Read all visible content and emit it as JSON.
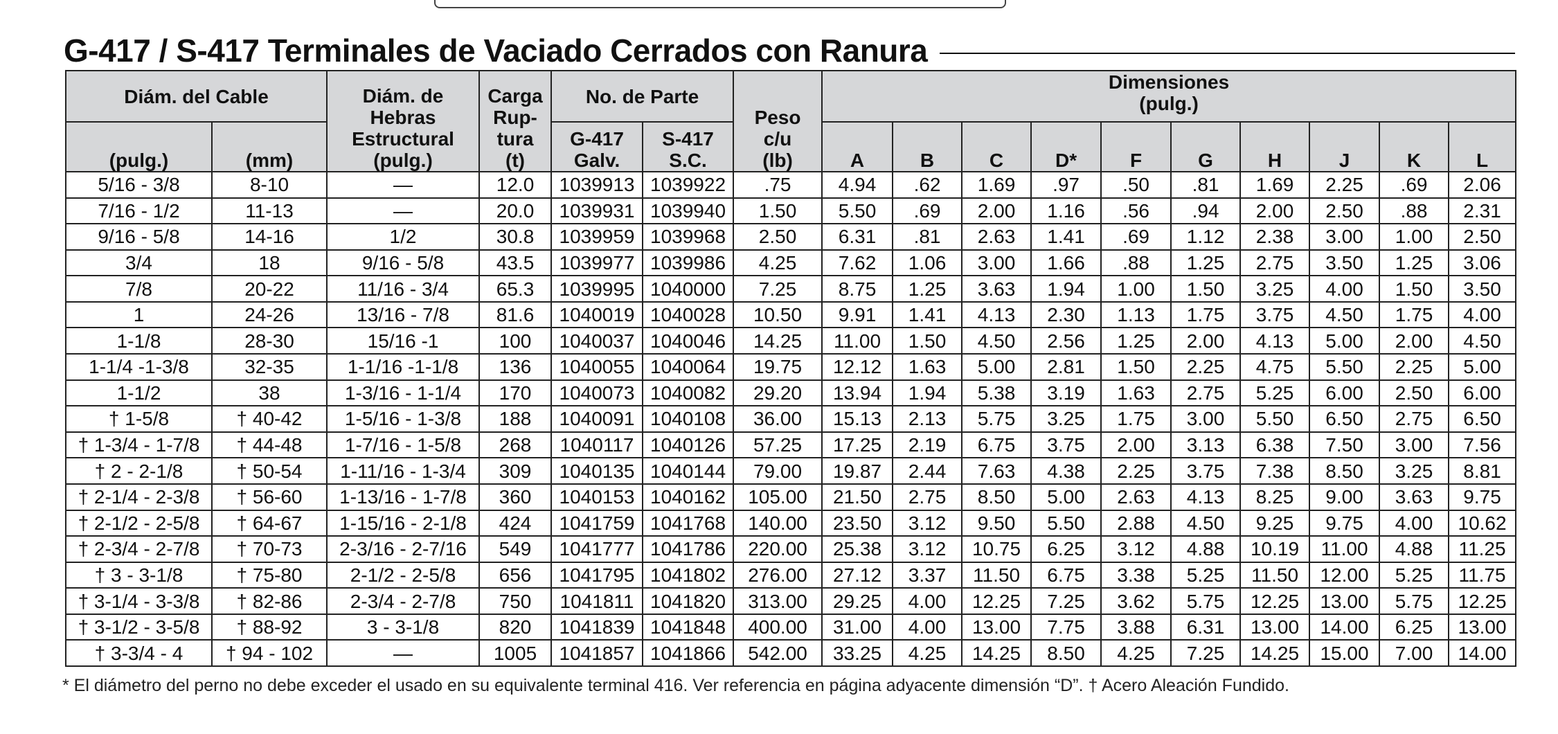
{
  "title": "G-417 / S-417 Terminales de Vaciado Cerrados con Ranura",
  "header": {
    "cable_diam": "Diám. del Cable",
    "pulg": "(pulg.)",
    "mm": "(mm)",
    "strand_l1": "Diám. de",
    "strand_l2": "Hebras",
    "strand_l3": "Estructural",
    "strand_l4": "(pulg.)",
    "load_l1": "Carga",
    "load_l2": "Rup-",
    "load_l3": "tura",
    "load_l4": "(t)",
    "part_no": "No. de Parte",
    "g417_l1": "G-417",
    "g417_l2": "Galv.",
    "s417_l1": "S-417",
    "s417_l2": "S.C.",
    "weight_l1": "Peso",
    "weight_l2": "c/u",
    "weight_l3": "(lb)",
    "dims_l1": "Dimensiones",
    "dims_l2": "(pulg.)",
    "dim_letters": [
      "A",
      "B",
      "C",
      "D*",
      "F",
      "G",
      "H",
      "J",
      "K",
      "L"
    ]
  },
  "rows": [
    [
      "5/16 - 3/8",
      "8-10",
      "—",
      "12.0",
      "1039913",
      "1039922",
      ".75",
      "4.94",
      ".62",
      "1.69",
      ".97",
      ".50",
      ".81",
      "1.69",
      "2.25",
      ".69",
      "2.06"
    ],
    [
      "7/16 - 1/2",
      "11-13",
      "—",
      "20.0",
      "1039931",
      "1039940",
      "1.50",
      "5.50",
      ".69",
      "2.00",
      "1.16",
      ".56",
      ".94",
      "2.00",
      "2.50",
      ".88",
      "2.31"
    ],
    [
      "9/16 - 5/8",
      "14-16",
      "1/2",
      "30.8",
      "1039959",
      "1039968",
      "2.50",
      "6.31",
      ".81",
      "2.63",
      "1.41",
      ".69",
      "1.12",
      "2.38",
      "3.00",
      "1.00",
      "2.50"
    ],
    [
      "3/4",
      "18",
      "9/16 - 5/8",
      "43.5",
      "1039977",
      "1039986",
      "4.25",
      "7.62",
      "1.06",
      "3.00",
      "1.66",
      ".88",
      "1.25",
      "2.75",
      "3.50",
      "1.25",
      "3.06"
    ],
    [
      "7/8",
      "20-22",
      "11/16 - 3/4",
      "65.3",
      "1039995",
      "1040000",
      "7.25",
      "8.75",
      "1.25",
      "3.63",
      "1.94",
      "1.00",
      "1.50",
      "3.25",
      "4.00",
      "1.50",
      "3.50"
    ],
    [
      "1",
      "24-26",
      "13/16 - 7/8",
      "81.6",
      "1040019",
      "1040028",
      "10.50",
      "9.91",
      "1.41",
      "4.13",
      "2.30",
      "1.13",
      "1.75",
      "3.75",
      "4.50",
      "1.75",
      "4.00"
    ],
    [
      "1-1/8",
      "28-30",
      "15/16 -1",
      "100",
      "1040037",
      "1040046",
      "14.25",
      "11.00",
      "1.50",
      "4.50",
      "2.56",
      "1.25",
      "2.00",
      "4.13",
      "5.00",
      "2.00",
      "4.50"
    ],
    [
      "1-1/4 -1-3/8",
      "32-35",
      "1-1/16 -1-1/8",
      "136",
      "1040055",
      "1040064",
      "19.75",
      "12.12",
      "1.63",
      "5.00",
      "2.81",
      "1.50",
      "2.25",
      "4.75",
      "5.50",
      "2.25",
      "5.00"
    ],
    [
      "1-1/2",
      "38",
      "1-3/16 - 1-1/4",
      "170",
      "1040073",
      "1040082",
      "29.20",
      "13.94",
      "1.94",
      "5.38",
      "3.19",
      "1.63",
      "2.75",
      "5.25",
      "6.00",
      "2.50",
      "6.00"
    ],
    [
      "† 1-5/8",
      "† 40-42",
      "1-5/16 - 1-3/8",
      "188",
      "1040091",
      "1040108",
      "36.00",
      "15.13",
      "2.13",
      "5.75",
      "3.25",
      "1.75",
      "3.00",
      "5.50",
      "6.50",
      "2.75",
      "6.50"
    ],
    [
      "† 1-3/4 - 1-7/8",
      "† 44-48",
      "1-7/16 - 1-5/8",
      "268",
      "1040117",
      "1040126",
      "57.25",
      "17.25",
      "2.19",
      "6.75",
      "3.75",
      "2.00",
      "3.13",
      "6.38",
      "7.50",
      "3.00",
      "7.56"
    ],
    [
      "† 2 - 2-1/8",
      "† 50-54",
      "1-11/16 - 1-3/4",
      "309",
      "1040135",
      "1040144",
      "79.00",
      "19.87",
      "2.44",
      "7.63",
      "4.38",
      "2.25",
      "3.75",
      "7.38",
      "8.50",
      "3.25",
      "8.81"
    ],
    [
      "† 2-1/4 - 2-3/8",
      "† 56-60",
      "1-13/16 - 1-7/8",
      "360",
      "1040153",
      "1040162",
      "105.00",
      "21.50",
      "2.75",
      "8.50",
      "5.00",
      "2.63",
      "4.13",
      "8.25",
      "9.00",
      "3.63",
      "9.75"
    ],
    [
      "† 2-1/2 - 2-5/8",
      "† 64-67",
      "1-15/16 - 2-1/8",
      "424",
      "1041759",
      "1041768",
      "140.00",
      "23.50",
      "3.12",
      "9.50",
      "5.50",
      "2.88",
      "4.50",
      "9.25",
      "9.75",
      "4.00",
      "10.62"
    ],
    [
      "† 2-3/4 - 2-7/8",
      "† 70-73",
      "2-3/16 - 2-7/16",
      "549",
      "1041777",
      "1041786",
      "220.00",
      "25.38",
      "3.12",
      "10.75",
      "6.25",
      "3.12",
      "4.88",
      "10.19",
      "11.00",
      "4.88",
      "11.25"
    ],
    [
      "† 3 - 3-1/8",
      "† 75-80",
      "2-1/2 - 2-5/8",
      "656",
      "1041795",
      "1041802",
      "276.00",
      "27.12",
      "3.37",
      "11.50",
      "6.75",
      "3.38",
      "5.25",
      "11.50",
      "12.00",
      "5.25",
      "11.75"
    ],
    [
      "† 3-1/4 - 3-3/8",
      "† 82-86",
      "2-3/4 - 2-7/8",
      "750",
      "1041811",
      "1041820",
      "313.00",
      "29.25",
      "4.00",
      "12.25",
      "7.25",
      "3.62",
      "5.75",
      "12.25",
      "13.00",
      "5.75",
      "12.25"
    ],
    [
      "† 3-1/2 - 3-5/8",
      "† 88-92",
      "3 - 3-1/8",
      "820",
      "1041839",
      "1041848",
      "400.00",
      "31.00",
      "4.00",
      "13.00",
      "7.75",
      "3.88",
      "6.31",
      "13.00",
      "14.00",
      "6.25",
      "13.00"
    ],
    [
      "† 3-3/4 - 4",
      "† 94 - 102",
      "—",
      "1005",
      "1041857",
      "1041866",
      "542.00",
      "33.25",
      "4.25",
      "14.25",
      "8.50",
      "4.25",
      "7.25",
      "14.25",
      "15.00",
      "7.00",
      "14.00"
    ]
  ],
  "footnote": "* El diámetro del perno no debe exceder el usado en su equivalente terminal 416.  Ver referencia en página adyacente dimensión “D”.  † Acero Aleación Fundido."
}
